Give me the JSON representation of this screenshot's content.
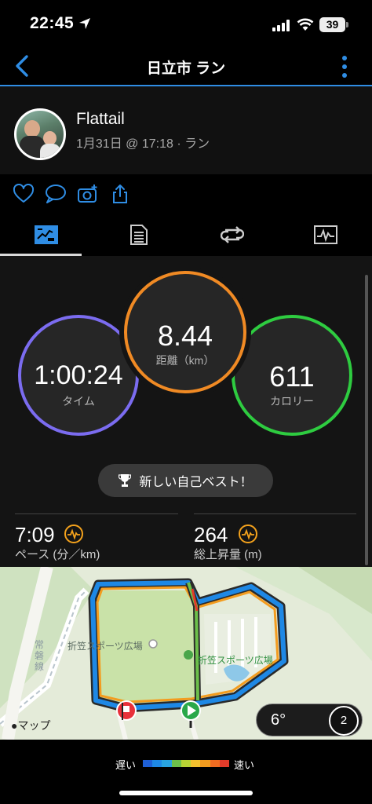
{
  "status_bar": {
    "time": "22:45",
    "battery": "39"
  },
  "nav": {
    "title": "日立市 ラン"
  },
  "profile": {
    "name": "Flattail",
    "meta": "1月31日 @ 17:18 · ラン"
  },
  "actions": [
    "like-icon",
    "comment-icon",
    "add-photo-icon",
    "share-icon"
  ],
  "tabs": [
    "stats-tab-icon",
    "details-tab-icon",
    "laps-tab-icon",
    "charts-tab-icon"
  ],
  "stats": {
    "time": {
      "value": "1:00:24",
      "label": "タイム",
      "color": "#7b6cf0"
    },
    "distance": {
      "value": "8.44",
      "label": "距離（km）",
      "color": "#f08a24"
    },
    "calories": {
      "value": "611",
      "label": "カロリー",
      "color": "#2ecc40"
    },
    "personal_record": "新しい自己ベスト！",
    "pace": {
      "value": "7:09",
      "label": "ペース (分／km)"
    },
    "elevation": {
      "value": "264",
      "label": "総上昇量 (m)"
    }
  },
  "map": {
    "place_label_1": "折笠スポーツ広場",
    "place_label_2": "折笠スポーツ広場",
    "railway_label": "常磐線",
    "credit": "マップ",
    "weather_temp": "6°",
    "wind_speed": "2"
  },
  "legend": {
    "slow": "遅い",
    "fast": "速い",
    "colors": [
      "#1e5fd6",
      "#1e88e5",
      "#29a3e0",
      "#6cc04a",
      "#b7d334",
      "#f2c12e",
      "#f39c1f",
      "#ef6c21",
      "#e23b2a"
    ]
  }
}
